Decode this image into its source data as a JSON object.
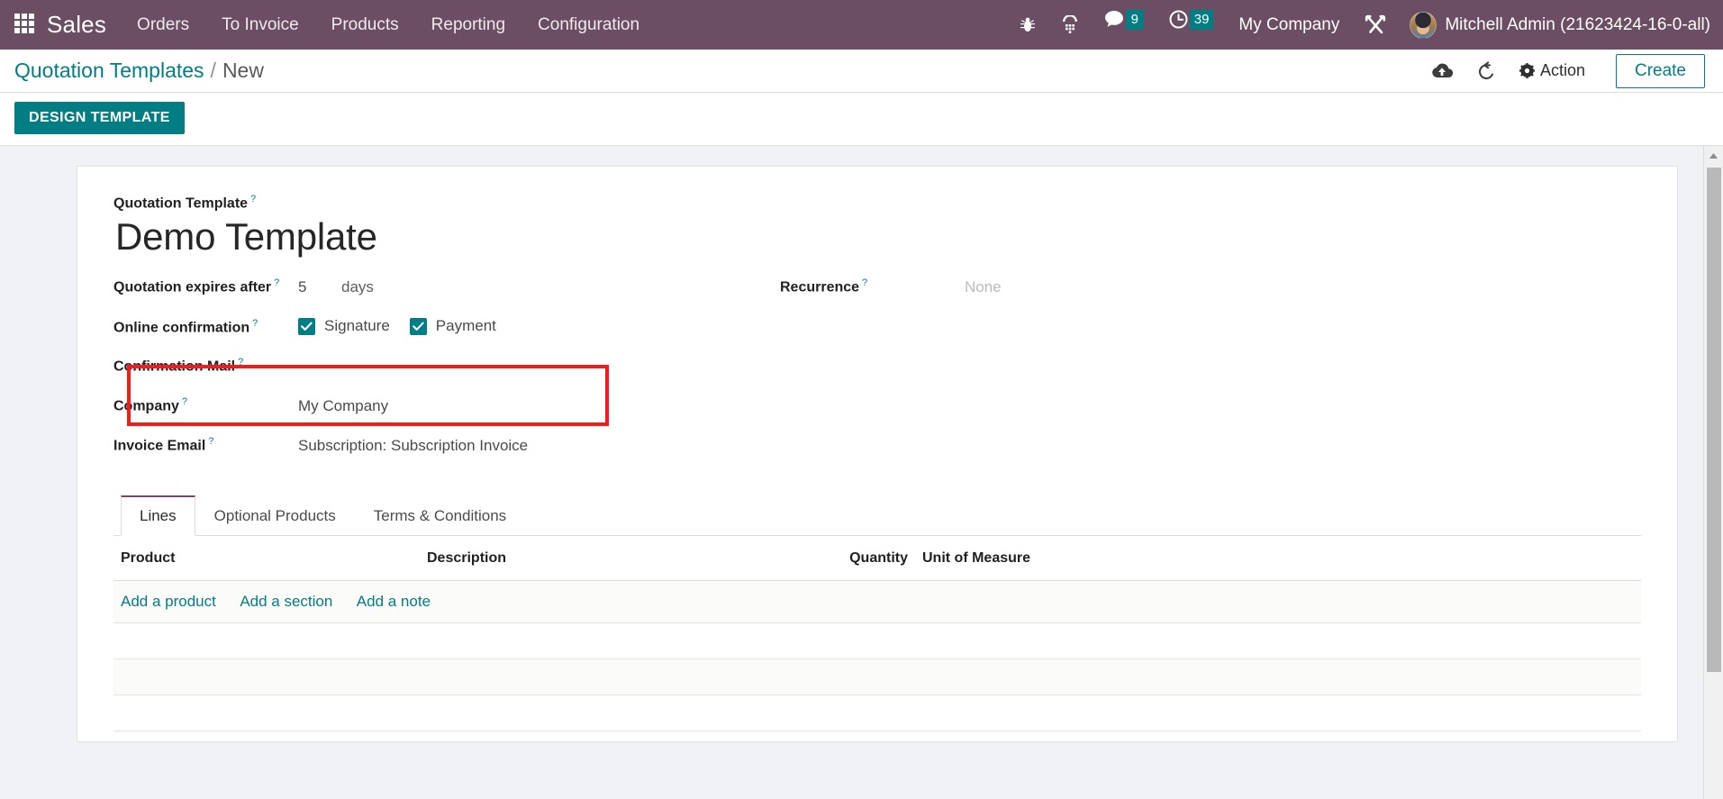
{
  "navbar": {
    "apps_icon": "apps-grid-icon",
    "brand": "Sales",
    "menu": [
      {
        "label": "Orders"
      },
      {
        "label": "To Invoice"
      },
      {
        "label": "Products"
      },
      {
        "label": "Reporting"
      },
      {
        "label": "Configuration"
      }
    ],
    "icons": [
      {
        "name": "bug-icon"
      },
      {
        "name": "dialpad-icon"
      }
    ],
    "messages": {
      "icon": "chat-bubble-icon",
      "count": "9"
    },
    "activities": {
      "icon": "clock-icon",
      "count": "39"
    },
    "company": "My Company",
    "debug_icon": "tools-icon",
    "user": "Mitchell Admin (21623424-16-0-all)",
    "colors": {
      "bar": "#6b4e63",
      "badge": "#017e84"
    }
  },
  "control_panel": {
    "breadcrumb_root": "Quotation Templates",
    "breadcrumb_separator": "/",
    "breadcrumb_current": "New",
    "save_icon": "cloud-upload-icon",
    "discard_icon": "undo-icon",
    "action_label": "Action",
    "action_icon": "gear-icon",
    "create_label": "Create"
  },
  "subbar": {
    "design_template_label": "DESIGN TEMPLATE"
  },
  "form": {
    "subtitle_label": "Quotation Template",
    "title": "Demo Template",
    "help_mark": "?",
    "fields": {
      "expires_label": "Quotation expires after",
      "expires_value": "5",
      "expires_unit": "days",
      "online_confirmation_label": "Online confirmation",
      "signature_label": "Signature",
      "payment_label": "Payment",
      "signature_checked": true,
      "payment_checked": true,
      "confirmation_mail_label": "Confirmation Mail",
      "confirmation_mail_value": "",
      "company_label": "Company",
      "company_value": "My Company",
      "invoice_email_label": "Invoice Email",
      "invoice_email_value": "Subscription: Subscription Invoice",
      "recurrence_label": "Recurrence",
      "recurrence_value": "None"
    },
    "annotation": {
      "color": "#f51b1b",
      "targets": "Confirmation Mail and Company fields"
    }
  },
  "notebook": {
    "tabs": [
      {
        "label": "Lines",
        "active": true
      },
      {
        "label": "Optional Products",
        "active": false
      },
      {
        "label": "Terms & Conditions",
        "active": false
      }
    ],
    "lines": {
      "columns": [
        "Product",
        "Description",
        "Quantity",
        "Unit of Measure"
      ],
      "rows": [],
      "add_links": [
        "Add a product",
        "Add a section",
        "Add a note"
      ]
    }
  },
  "scrollbar": {
    "up_arrow_icon": "caret-up-icon"
  }
}
